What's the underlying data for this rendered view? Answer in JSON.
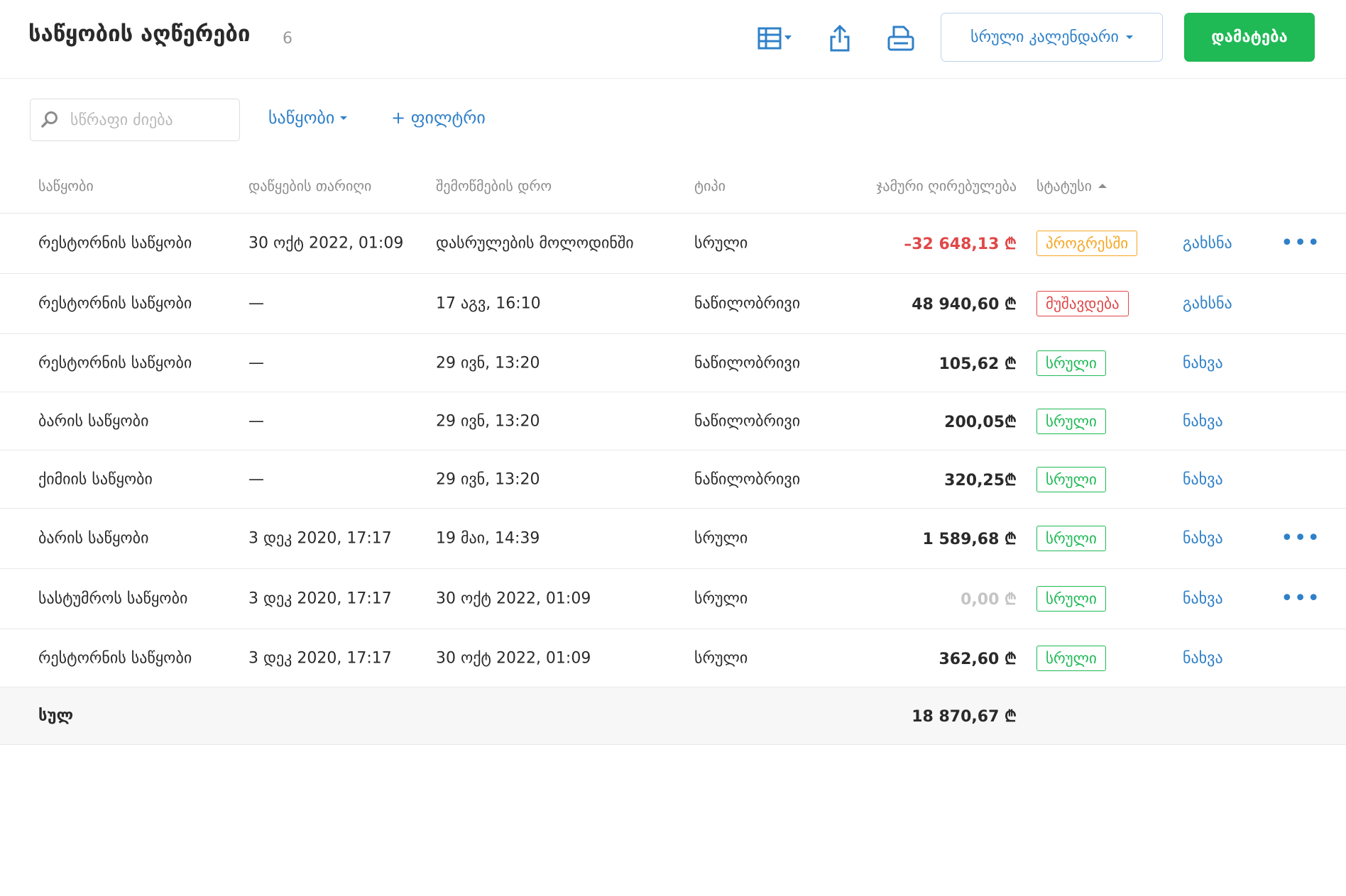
{
  "header": {
    "title": "საწყობის აღწერები",
    "count": "6",
    "calendar_label": "სრული კალენდარი",
    "add_label": "დამატება",
    "colors": {
      "accent": "#2f80c8",
      "primary": "#1fb955"
    }
  },
  "toolbar": {
    "search_placeholder": "სწრაფი ძიება",
    "warehouse_filter": "საწყობი",
    "add_filter": "+ ფილტრი"
  },
  "table": {
    "columns": [
      "საწყობი",
      "დაწყების თარიღი",
      "შემოწმების დრო",
      "ტიპი",
      "ჯამური ღირებულება",
      "სტატუსი"
    ],
    "rows": [
      {
        "warehouse": "რესტორნის საწყობი",
        "start": "30 ოქტ 2022, 01:09",
        "check": "დასრულების მოლოდინში",
        "type": "სრული",
        "total": "–32 648,13 ₾",
        "status": "პროგრესში",
        "status_color": "#f5a623",
        "action": "გახსნა",
        "more": true,
        "total_color": "#e04848"
      },
      {
        "warehouse": "რესტორნის საწყობი",
        "start": "—",
        "check": "17 აგვ, 16:10",
        "type": "ნაწილობრივი",
        "total": "48 940,60 ₾",
        "status": "მუშავდება",
        "status_color": "#e04848",
        "action": "გახსნა",
        "more": false,
        "total_color": "#2a2a2a"
      },
      {
        "warehouse": "რესტორნის საწყობი",
        "start": "—",
        "check": "29 ივნ, 13:20",
        "type": "ნაწილობრივი",
        "total": "105,62 ₾",
        "status": "სრული",
        "status_color": "#1fb955",
        "action": "ნახვა",
        "more": false,
        "total_color": "#2a2a2a"
      },
      {
        "warehouse": "ბარის საწყობი",
        "start": "—",
        "check": "29 ივნ, 13:20",
        "type": "ნაწილობრივი",
        "total": "200,05₾",
        "status": "სრული",
        "status_color": "#1fb955",
        "action": "ნახვა",
        "more": false,
        "total_color": "#2a2a2a"
      },
      {
        "warehouse": "ქიმიის საწყობი",
        "start": "—",
        "check": "29 ივნ, 13:20",
        "type": "ნაწილობრივი",
        "total": "320,25₾",
        "status": "სრული",
        "status_color": "#1fb955",
        "action": "ნახვა",
        "more": false,
        "total_color": "#2a2a2a"
      },
      {
        "warehouse": "ბარის საწყობი",
        "start": "3 დეკ 2020, 17:17",
        "check": "19 მაი, 14:39",
        "type": "სრული",
        "total": "1 589,68 ₾",
        "status": "სრული",
        "status_color": "#1fb955",
        "action": "ნახვა",
        "more": true,
        "total_color": "#2a2a2a"
      },
      {
        "warehouse": "სასტუმროს საწყობი",
        "start": "3 დეკ 2020, 17:17",
        "check": "30 ოქტ 2022, 01:09",
        "type": "სრული",
        "total": "0,00 ₾",
        "status": "სრული",
        "status_color": "#1fb955",
        "action": "ნახვა",
        "more": true,
        "total_color": "#c4c4c4"
      },
      {
        "warehouse": "რესტორნის საწყობი",
        "start": "3 დეკ 2020, 17:17",
        "check": "30 ოქტ 2022, 01:09",
        "type": "სრული",
        "total": "362,60 ₾",
        "status": "სრული",
        "status_color": "#1fb955",
        "action": "ნახვა",
        "more": false,
        "total_color": "#2a2a2a"
      }
    ],
    "total_label": "სულ",
    "total_value": "18 870,67 ₾"
  }
}
